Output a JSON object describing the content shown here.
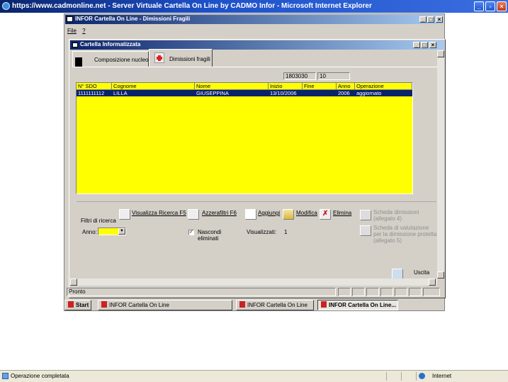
{
  "browser": {
    "title": "https://www.cadmonline.net - Server Virtuale Cartella On Line by CADMO Infor - Microsoft Internet Explorer",
    "status_text": "Operazione completata",
    "zone": "Internet"
  },
  "app_window": {
    "title": "INFOR Cartella On Line - Dimissioni Fragili",
    "menu": [
      "File",
      "?"
    ]
  },
  "child_window": {
    "title": "Cartella Informatizzata",
    "tabs": [
      {
        "label": "Composizione nucleo",
        "active": false
      },
      {
        "label": "Dimissioni fragili",
        "active": true
      }
    ]
  },
  "fields": {
    "code": "1803030",
    "number": "10"
  },
  "table": {
    "columns": [
      "N° SDO",
      "Cognome",
      "Nome",
      "Inizio",
      "Fine",
      "Anno",
      "Operazione"
    ],
    "rows": [
      [
        "1111111112",
        "LILLA",
        "GIUSEPPINA",
        "13/10/2006",
        "",
        "2006",
        "aggiornato"
      ]
    ]
  },
  "toolbar": {
    "filters_label": "Filtri di ricerca",
    "search_button": "Visualizza Ricerca F5",
    "reset_button": "Azzerafiltri  F6",
    "add_button": "Aggiungi",
    "edit_button": "Modifica",
    "delete_button": "Elimina",
    "discharge_form_line1": "Scheda dimissioni",
    "discharge_form_line2": "(allegato 4)",
    "eval_form_line1": "Scheda di valutazione",
    "eval_form_line2": "per la dimissione protetta",
    "eval_form_line3": "(allegato 5)",
    "year_label": "Anno:",
    "year_value": "",
    "hide_deleted_line1": "Nascondi",
    "hide_deleted_line2": "eliminati",
    "hide_deleted_checked": true,
    "shown_label": "Visualizzati:",
    "shown_count": "1",
    "exit_button": "Uscita"
  },
  "status_bar": {
    "text": "Pronto"
  },
  "taskbar": {
    "start": "Start",
    "items": [
      "INFOR Cartella On Line",
      "INFOR Cartella On Line",
      "INFOR Cartella On Line..."
    ]
  },
  "colors": {
    "grid": "#ffff00",
    "selection": "#0a246a",
    "title_start": "#0a246a",
    "title_end": "#a6caf0"
  }
}
